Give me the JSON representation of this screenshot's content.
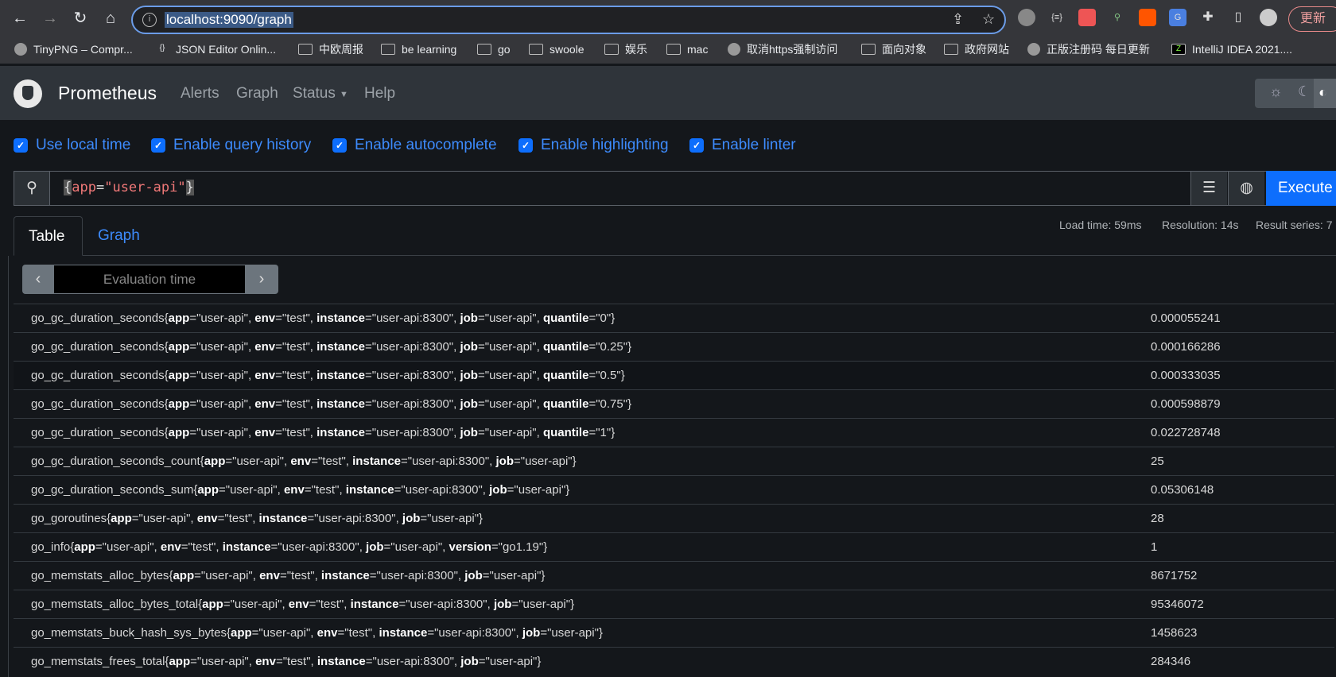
{
  "browser": {
    "url": "localhost:9090/graph",
    "update_label": "更新",
    "bookmarks": [
      {
        "label": "TinyPNG – Compr...",
        "icon": "tinypng-icon"
      },
      {
        "label": "JSON Editor Onlin...",
        "icon": "json-icon"
      },
      {
        "label": "中欧周报",
        "icon": "folder-icon"
      },
      {
        "label": "be learning",
        "icon": "folder-icon"
      },
      {
        "label": "go",
        "icon": "folder-icon"
      },
      {
        "label": "swoole",
        "icon": "folder-icon"
      },
      {
        "label": "娱乐",
        "icon": "folder-icon"
      },
      {
        "label": "mac",
        "icon": "folder-icon"
      },
      {
        "label": "取消https强制访问",
        "icon": "globe-icon"
      },
      {
        "label": "面向对象",
        "icon": "folder-icon"
      },
      {
        "label": "政府网站",
        "icon": "folder-icon"
      },
      {
        "label": "正版注册码 每日更新",
        "icon": "globe-icon"
      },
      {
        "label": "IntelliJ IDEA 2021....",
        "icon": "intellij-icon"
      }
    ]
  },
  "navbar": {
    "brand": "Prometheus",
    "links": [
      "Alerts",
      "Graph",
      "Status",
      "Help"
    ]
  },
  "options": [
    {
      "label": "Use local time",
      "checked": true
    },
    {
      "label": "Enable query history",
      "checked": true
    },
    {
      "label": "Enable autocomplete",
      "checked": true
    },
    {
      "label": "Enable highlighting",
      "checked": true
    },
    {
      "label": "Enable linter",
      "checked": true
    }
  ],
  "query": {
    "open": "{",
    "label": "app",
    "eq": "=",
    "value": "\"user-api\"",
    "close": "}",
    "execute_label": "Execute"
  },
  "tabs": {
    "table": "Table",
    "graph": "Graph"
  },
  "stats": {
    "load_time": "Load time: 59ms",
    "resolution": "Resolution: 14s",
    "result_series": "Result series: 7"
  },
  "eval": {
    "placeholder": "Evaluation time"
  },
  "colors": {
    "accent": "#0d6efd",
    "link": "#3d8bfd",
    "navbar": "#2f343a",
    "background": "#14171b"
  },
  "results": [
    {
      "metric": "go_gc_duration_seconds",
      "labels": [
        [
          "app",
          "user-api"
        ],
        [
          "env",
          "test"
        ],
        [
          "instance",
          "user-api:8300"
        ],
        [
          "job",
          "user-api"
        ],
        [
          "quantile",
          "0"
        ]
      ],
      "value": "0.000055241"
    },
    {
      "metric": "go_gc_duration_seconds",
      "labels": [
        [
          "app",
          "user-api"
        ],
        [
          "env",
          "test"
        ],
        [
          "instance",
          "user-api:8300"
        ],
        [
          "job",
          "user-api"
        ],
        [
          "quantile",
          "0.25"
        ]
      ],
      "value": "0.000166286"
    },
    {
      "metric": "go_gc_duration_seconds",
      "labels": [
        [
          "app",
          "user-api"
        ],
        [
          "env",
          "test"
        ],
        [
          "instance",
          "user-api:8300"
        ],
        [
          "job",
          "user-api"
        ],
        [
          "quantile",
          "0.5"
        ]
      ],
      "value": "0.000333035"
    },
    {
      "metric": "go_gc_duration_seconds",
      "labels": [
        [
          "app",
          "user-api"
        ],
        [
          "env",
          "test"
        ],
        [
          "instance",
          "user-api:8300"
        ],
        [
          "job",
          "user-api"
        ],
        [
          "quantile",
          "0.75"
        ]
      ],
      "value": "0.000598879"
    },
    {
      "metric": "go_gc_duration_seconds",
      "labels": [
        [
          "app",
          "user-api"
        ],
        [
          "env",
          "test"
        ],
        [
          "instance",
          "user-api:8300"
        ],
        [
          "job",
          "user-api"
        ],
        [
          "quantile",
          "1"
        ]
      ],
      "value": "0.022728748"
    },
    {
      "metric": "go_gc_duration_seconds_count",
      "labels": [
        [
          "app",
          "user-api"
        ],
        [
          "env",
          "test"
        ],
        [
          "instance",
          "user-api:8300"
        ],
        [
          "job",
          "user-api"
        ]
      ],
      "value": "25"
    },
    {
      "metric": "go_gc_duration_seconds_sum",
      "labels": [
        [
          "app",
          "user-api"
        ],
        [
          "env",
          "test"
        ],
        [
          "instance",
          "user-api:8300"
        ],
        [
          "job",
          "user-api"
        ]
      ],
      "value": "0.05306148"
    },
    {
      "metric": "go_goroutines",
      "labels": [
        [
          "app",
          "user-api"
        ],
        [
          "env",
          "test"
        ],
        [
          "instance",
          "user-api:8300"
        ],
        [
          "job",
          "user-api"
        ]
      ],
      "value": "28"
    },
    {
      "metric": "go_info",
      "labels": [
        [
          "app",
          "user-api"
        ],
        [
          "env",
          "test"
        ],
        [
          "instance",
          "user-api:8300"
        ],
        [
          "job",
          "user-api"
        ],
        [
          "version",
          "go1.19"
        ]
      ],
      "value": "1"
    },
    {
      "metric": "go_memstats_alloc_bytes",
      "labels": [
        [
          "app",
          "user-api"
        ],
        [
          "env",
          "test"
        ],
        [
          "instance",
          "user-api:8300"
        ],
        [
          "job",
          "user-api"
        ]
      ],
      "value": "8671752"
    },
    {
      "metric": "go_memstats_alloc_bytes_total",
      "labels": [
        [
          "app",
          "user-api"
        ],
        [
          "env",
          "test"
        ],
        [
          "instance",
          "user-api:8300"
        ],
        [
          "job",
          "user-api"
        ]
      ],
      "value": "95346072"
    },
    {
      "metric": "go_memstats_buck_hash_sys_bytes",
      "labels": [
        [
          "app",
          "user-api"
        ],
        [
          "env",
          "test"
        ],
        [
          "instance",
          "user-api:8300"
        ],
        [
          "job",
          "user-api"
        ]
      ],
      "value": "1458623"
    },
    {
      "metric": "go_memstats_frees_total",
      "labels": [
        [
          "app",
          "user-api"
        ],
        [
          "env",
          "test"
        ],
        [
          "instance",
          "user-api:8300"
        ],
        [
          "job",
          "user-api"
        ]
      ],
      "value": "284346"
    }
  ]
}
